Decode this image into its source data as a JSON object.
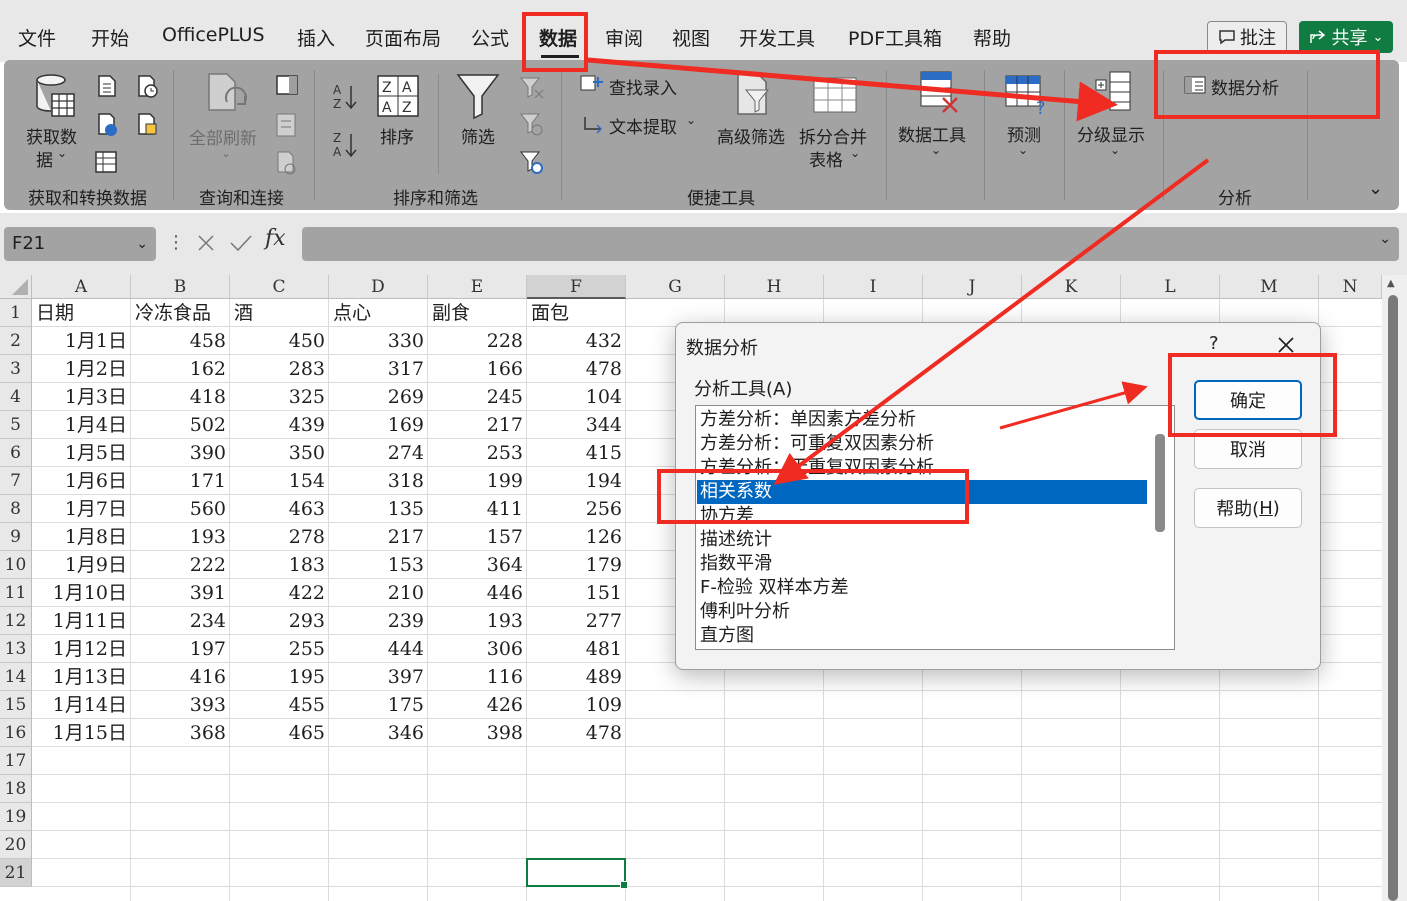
{
  "menu": {
    "items": [
      "文件",
      "开始",
      "OfficePLUS",
      "插入",
      "页面布局",
      "公式",
      "数据",
      "审阅",
      "视图",
      "开发工具",
      "PDF工具箱",
      "帮助"
    ],
    "active": "数据",
    "comment_label": "批注",
    "share_label": "共享",
    "share_color": "#107c41"
  },
  "ribbon": {
    "get_data_label": "获取数",
    "get_data_label2": "据",
    "refresh_all_label": "全部刷新",
    "sort_label": "排序",
    "filter_label": "筛选",
    "lookup_entry_label": "查找录入",
    "text_extract_label": "文本提取",
    "advanced_filter_label": "高级筛选",
    "split_merge_label": "拆分合并",
    "split_merge_label2": "表格",
    "data_tools_label": "数据工具",
    "forecast_label": "预测",
    "outline_label": "分级显示",
    "data_analysis_label": "数据分析",
    "groups": {
      "get_transform": "获取和转换数据",
      "queries": "查询和连接",
      "sort_filter": "排序和筛选",
      "quick_tools": "便捷工具",
      "analysis": "分析"
    }
  },
  "formula_bar": {
    "name_box": "F21",
    "fx_symbol": "fx",
    "formula": ""
  },
  "sheet": {
    "columns": [
      "A",
      "B",
      "C",
      "D",
      "E",
      "F",
      "G",
      "H",
      "I",
      "J",
      "K",
      "L",
      "M",
      "N"
    ],
    "selected_column": "F",
    "selected_row": 21,
    "row_count": 21,
    "headers": [
      "日期",
      "冷冻食品",
      "酒",
      "点心",
      "副食",
      "面包"
    ],
    "rows": [
      [
        "1月1日",
        "458",
        "450",
        "330",
        "228",
        "432"
      ],
      [
        "1月2日",
        "162",
        "283",
        "317",
        "166",
        "478"
      ],
      [
        "1月3日",
        "418",
        "325",
        "269",
        "245",
        "104"
      ],
      [
        "1月4日",
        "502",
        "439",
        "169",
        "217",
        "344"
      ],
      [
        "1月5日",
        "390",
        "350",
        "274",
        "253",
        "415"
      ],
      [
        "1月6日",
        "171",
        "154",
        "318",
        "199",
        "194"
      ],
      [
        "1月7日",
        "560",
        "463",
        "135",
        "411",
        "256"
      ],
      [
        "1月8日",
        "193",
        "278",
        "217",
        "157",
        "126"
      ],
      [
        "1月9日",
        "222",
        "183",
        "153",
        "364",
        "179"
      ],
      [
        "1月10日",
        "391",
        "422",
        "210",
        "446",
        "151"
      ],
      [
        "1月11日",
        "234",
        "293",
        "239",
        "193",
        "277"
      ],
      [
        "1月12日",
        "197",
        "255",
        "444",
        "306",
        "481"
      ],
      [
        "1月13日",
        "416",
        "195",
        "397",
        "116",
        "489"
      ],
      [
        "1月14日",
        "393",
        "455",
        "175",
        "426",
        "109"
      ],
      [
        "1月15日",
        "368",
        "465",
        "346",
        "398",
        "478"
      ]
    ]
  },
  "dialog": {
    "title": "数据分析",
    "help_q": "?",
    "list_label": "分析工具(A)",
    "tools": [
      "方差分析：单因素方差分析",
      "方差分析：可重复双因素分析",
      "方差分析：无重复双因素分析",
      "相关系数",
      "协方差",
      "描述统计",
      "指数平滑",
      "F-检验 双样本方差",
      "傅利叶分析",
      "直方图"
    ],
    "selected_tool": "相关系数",
    "ok_label": "确定",
    "cancel_label": "取消",
    "help_label": "帮助(",
    "help_key": "H",
    "help_close": ")",
    "selection_color": "#0067c0"
  },
  "annotation_color": "#ef2b22"
}
